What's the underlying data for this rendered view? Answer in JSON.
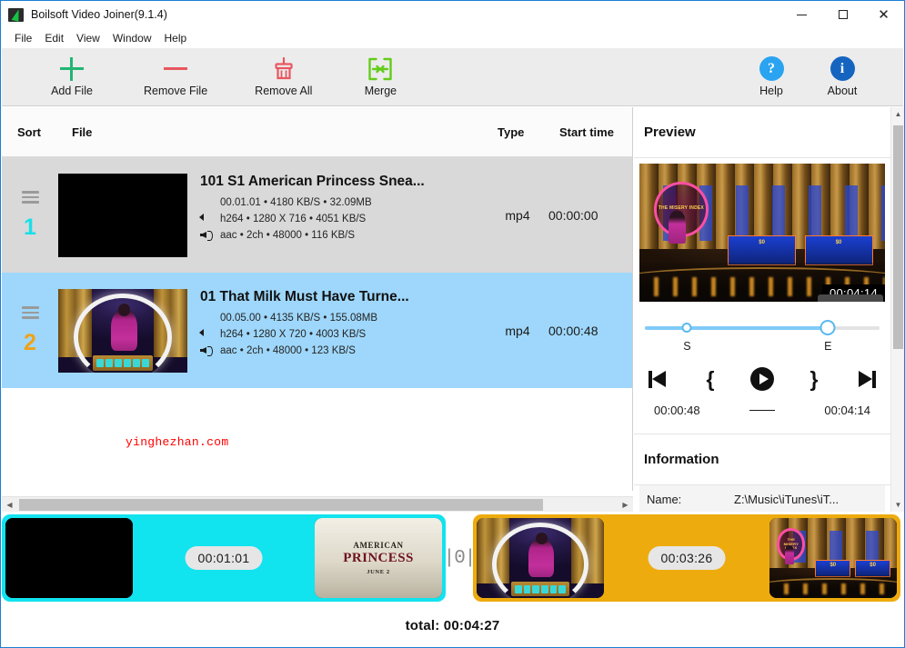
{
  "window": {
    "title": "Boilsoft Video Joiner(9.1.4)",
    "icon": "app-icon",
    "controls": {
      "minimize": "—",
      "maximize": "□",
      "close": "✕"
    }
  },
  "menu": {
    "items": [
      {
        "label": "File"
      },
      {
        "label": "Edit"
      },
      {
        "label": "View"
      },
      {
        "label": "Window"
      },
      {
        "label": "Help"
      }
    ]
  },
  "toolbar": {
    "add_file": "Add File",
    "remove_file": "Remove File",
    "remove_all": "Remove All",
    "merge": "Merge",
    "help": "Help",
    "about": "About",
    "help_glyph": "?",
    "about_glyph": "i",
    "colors": {
      "add": "#22b573",
      "remove": "#e8575f",
      "remove_all": "#e8575f",
      "merge": "#63cc1a",
      "help_circle": "#2aa3f0",
      "about_circle": "#1565c0"
    }
  },
  "file_list": {
    "columns": {
      "sort": "Sort",
      "file": "File",
      "type": "Type",
      "start_time": "Start time"
    },
    "rows": [
      {
        "index": "1",
        "index_color": "#18e0e8",
        "selected": false,
        "title": "101 S1 American Princess Snea...",
        "file_info": "00.01.01 •  4180 KB/S • 32.09MB",
        "video_info": "h264 • 1280 X 716 • 4051 KB/S",
        "audio_info": "aac • 2ch • 48000 • 116 KB/S",
        "type": "mp4",
        "start_time": "00:00:00",
        "thumbnail": "black-frame"
      },
      {
        "index": "2",
        "index_color": "#f0a21a",
        "selected": true,
        "title": "01 That Milk Must Have Turne...",
        "file_info": "00.05.00 •  4135 KB/S • 155.08MB",
        "video_info": "h264 • 1280 X 720 • 4003 KB/S",
        "audio_info": "aac • 2ch • 48000 • 123 KB/S",
        "type": "mp4",
        "start_time": "00:00:48",
        "thumbnail": "stage-frame"
      }
    ],
    "watermark": "yinghezhan.com"
  },
  "preview": {
    "section_title": "Preview",
    "overlay_time": "00:04:14",
    "tooltip_time": "00:04:14",
    "marker_start_label": "S",
    "marker_end_label": "E",
    "start_time": "00:00:48",
    "end_time": "00:04:14",
    "separator": "—",
    "controls": {
      "previous": "skip-previous-icon",
      "mark_in": "{",
      "play": "play-icon",
      "mark_out": "}",
      "next": "skip-next-icon"
    }
  },
  "information": {
    "section_title": "Information",
    "rows": [
      {
        "key": "Name:",
        "value": "Z:\\Music\\iTunes\\iT..."
      }
    ]
  },
  "timeline": {
    "clips": [
      {
        "duration": "00:01:01",
        "color": "#11e3ef",
        "start_thumb": "black-frame",
        "end_thumb": "american-princess-poster"
      },
      {
        "duration": "00:03:26",
        "color": "#eeab0d",
        "start_thumb": "stage-frame",
        "end_thumb": "misery-index-frame"
      }
    ],
    "joiner_glyph": "|0|",
    "total_label": "total: 00:04:27"
  },
  "poster": {
    "line1": "AMERICAN",
    "line2": "PRINCESS",
    "line3": "JUNE 2"
  },
  "show_logo": "THE MISERY INDEX",
  "scrollbars": {
    "h_left_arrow": "◀",
    "h_right_arrow": "▶",
    "v_up_arrow": "▲",
    "v_down_arrow": "▼"
  }
}
